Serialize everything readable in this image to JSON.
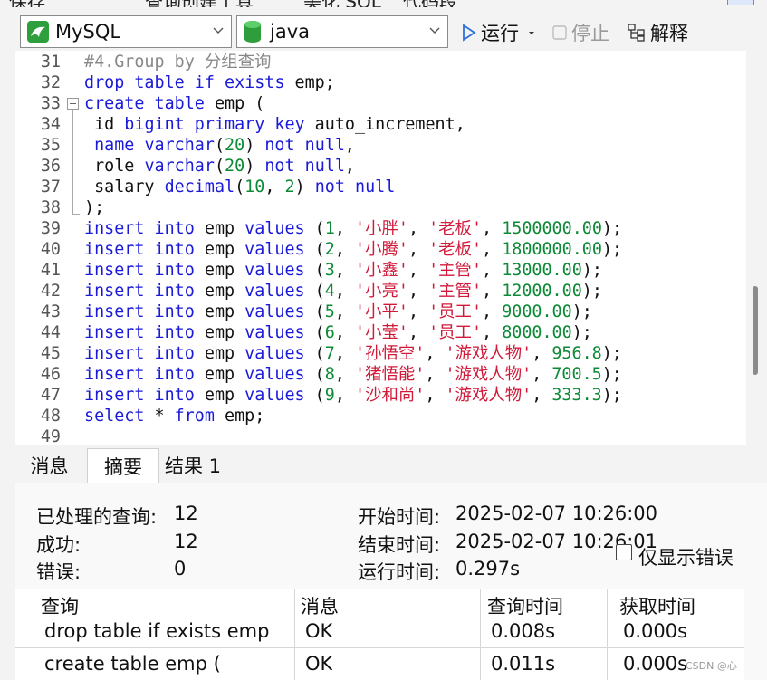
{
  "top_toolbar": {
    "fragments": [
      "保存",
      "查询创建工具",
      "美化 SQL",
      "代码段"
    ]
  },
  "toolbar": {
    "connection_value": "MySQL",
    "database_value": "java",
    "run_label": "运行",
    "stop_label": "停止",
    "explain_label": "解释"
  },
  "editor": {
    "lines": [
      {
        "n": "31",
        "tokens": [
          {
            "t": "#4.Group by 分组查询",
            "c": "cm"
          }
        ]
      },
      {
        "n": "32",
        "tokens": [
          {
            "t": "drop table if exists",
            "c": "kw"
          },
          {
            "t": " emp;",
            "c": "id"
          }
        ]
      },
      {
        "n": "33",
        "tokens": [
          {
            "t": "create table",
            "c": "kw"
          },
          {
            "t": " emp (",
            "c": "id"
          }
        ]
      },
      {
        "n": "34",
        "tokens": [
          {
            "t": " id ",
            "c": "id"
          },
          {
            "t": "bigint primary key",
            "c": "kw"
          },
          {
            "t": " auto_increment,",
            "c": "id"
          }
        ]
      },
      {
        "n": "35",
        "tokens": [
          {
            "t": " ",
            "c": "id"
          },
          {
            "t": "name varchar",
            "c": "kw"
          },
          {
            "t": "(",
            "c": "id"
          },
          {
            "t": "20",
            "c": "num"
          },
          {
            "t": ") ",
            "c": "id"
          },
          {
            "t": "not null",
            "c": "kw"
          },
          {
            "t": ",",
            "c": "id"
          }
        ]
      },
      {
        "n": "36",
        "tokens": [
          {
            "t": " role ",
            "c": "id"
          },
          {
            "t": "varchar",
            "c": "kw"
          },
          {
            "t": "(",
            "c": "id"
          },
          {
            "t": "20",
            "c": "num"
          },
          {
            "t": ") ",
            "c": "id"
          },
          {
            "t": "not null",
            "c": "kw"
          },
          {
            "t": ",",
            "c": "id"
          }
        ]
      },
      {
        "n": "37",
        "tokens": [
          {
            "t": " salary ",
            "c": "id"
          },
          {
            "t": "decimal",
            "c": "kw"
          },
          {
            "t": "(",
            "c": "id"
          },
          {
            "t": "10",
            "c": "num"
          },
          {
            "t": ", ",
            "c": "id"
          },
          {
            "t": "2",
            "c": "num"
          },
          {
            "t": ") ",
            "c": "id"
          },
          {
            "t": "not null",
            "c": "kw"
          }
        ]
      },
      {
        "n": "38",
        "tokens": [
          {
            "t": ");",
            "c": "id"
          }
        ]
      },
      {
        "n": "39",
        "tokens": [
          {
            "t": "insert into",
            "c": "kw"
          },
          {
            "t": " emp ",
            "c": "id"
          },
          {
            "t": "values",
            "c": "kw"
          },
          {
            "t": " (",
            "c": "id"
          },
          {
            "t": "1",
            "c": "num"
          },
          {
            "t": ", ",
            "c": "id"
          },
          {
            "t": "'小胖'",
            "c": "str"
          },
          {
            "t": ", ",
            "c": "id"
          },
          {
            "t": "'老板'",
            "c": "str"
          },
          {
            "t": ", ",
            "c": "id"
          },
          {
            "t": "1500000.00",
            "c": "num"
          },
          {
            "t": ");",
            "c": "id"
          }
        ]
      },
      {
        "n": "40",
        "tokens": [
          {
            "t": "insert into",
            "c": "kw"
          },
          {
            "t": " emp ",
            "c": "id"
          },
          {
            "t": "values",
            "c": "kw"
          },
          {
            "t": " (",
            "c": "id"
          },
          {
            "t": "2",
            "c": "num"
          },
          {
            "t": ", ",
            "c": "id"
          },
          {
            "t": "'小腾'",
            "c": "str"
          },
          {
            "t": ", ",
            "c": "id"
          },
          {
            "t": "'老板'",
            "c": "str"
          },
          {
            "t": ", ",
            "c": "id"
          },
          {
            "t": "1800000.00",
            "c": "num"
          },
          {
            "t": ");",
            "c": "id"
          }
        ]
      },
      {
        "n": "41",
        "tokens": [
          {
            "t": "insert into",
            "c": "kw"
          },
          {
            "t": " emp ",
            "c": "id"
          },
          {
            "t": "values",
            "c": "kw"
          },
          {
            "t": " (",
            "c": "id"
          },
          {
            "t": "3",
            "c": "num"
          },
          {
            "t": ", ",
            "c": "id"
          },
          {
            "t": "'小鑫'",
            "c": "str"
          },
          {
            "t": ", ",
            "c": "id"
          },
          {
            "t": "'主管'",
            "c": "str"
          },
          {
            "t": ", ",
            "c": "id"
          },
          {
            "t": "13000.00",
            "c": "num"
          },
          {
            "t": ");",
            "c": "id"
          }
        ]
      },
      {
        "n": "42",
        "tokens": [
          {
            "t": "insert into",
            "c": "kw"
          },
          {
            "t": " emp ",
            "c": "id"
          },
          {
            "t": "values",
            "c": "kw"
          },
          {
            "t": " (",
            "c": "id"
          },
          {
            "t": "4",
            "c": "num"
          },
          {
            "t": ", ",
            "c": "id"
          },
          {
            "t": "'小亮'",
            "c": "str"
          },
          {
            "t": ", ",
            "c": "id"
          },
          {
            "t": "'主管'",
            "c": "str"
          },
          {
            "t": ", ",
            "c": "id"
          },
          {
            "t": "12000.00",
            "c": "num"
          },
          {
            "t": ");",
            "c": "id"
          }
        ]
      },
      {
        "n": "43",
        "tokens": [
          {
            "t": "insert into",
            "c": "kw"
          },
          {
            "t": " emp ",
            "c": "id"
          },
          {
            "t": "values",
            "c": "kw"
          },
          {
            "t": " (",
            "c": "id"
          },
          {
            "t": "5",
            "c": "num"
          },
          {
            "t": ", ",
            "c": "id"
          },
          {
            "t": "'小平'",
            "c": "str"
          },
          {
            "t": ", ",
            "c": "id"
          },
          {
            "t": "'员工'",
            "c": "str"
          },
          {
            "t": ", ",
            "c": "id"
          },
          {
            "t": "9000.00",
            "c": "num"
          },
          {
            "t": ");",
            "c": "id"
          }
        ]
      },
      {
        "n": "44",
        "tokens": [
          {
            "t": "insert into",
            "c": "kw"
          },
          {
            "t": " emp ",
            "c": "id"
          },
          {
            "t": "values",
            "c": "kw"
          },
          {
            "t": " (",
            "c": "id"
          },
          {
            "t": "6",
            "c": "num"
          },
          {
            "t": ", ",
            "c": "id"
          },
          {
            "t": "'小莹'",
            "c": "str"
          },
          {
            "t": ", ",
            "c": "id"
          },
          {
            "t": "'员工'",
            "c": "str"
          },
          {
            "t": ", ",
            "c": "id"
          },
          {
            "t": "8000.00",
            "c": "num"
          },
          {
            "t": ");",
            "c": "id"
          }
        ]
      },
      {
        "n": "45",
        "tokens": [
          {
            "t": "insert into",
            "c": "kw"
          },
          {
            "t": " emp ",
            "c": "id"
          },
          {
            "t": "values",
            "c": "kw"
          },
          {
            "t": " (",
            "c": "id"
          },
          {
            "t": "7",
            "c": "num"
          },
          {
            "t": ", ",
            "c": "id"
          },
          {
            "t": "'孙悟空'",
            "c": "str"
          },
          {
            "t": ", ",
            "c": "id"
          },
          {
            "t": "'游戏人物'",
            "c": "str"
          },
          {
            "t": ", ",
            "c": "id"
          },
          {
            "t": "956.8",
            "c": "num"
          },
          {
            "t": ");",
            "c": "id"
          }
        ]
      },
      {
        "n": "46",
        "tokens": [
          {
            "t": "insert into",
            "c": "kw"
          },
          {
            "t": " emp ",
            "c": "id"
          },
          {
            "t": "values",
            "c": "kw"
          },
          {
            "t": " (",
            "c": "id"
          },
          {
            "t": "8",
            "c": "num"
          },
          {
            "t": ", ",
            "c": "id"
          },
          {
            "t": "'猪悟能'",
            "c": "str"
          },
          {
            "t": ", ",
            "c": "id"
          },
          {
            "t": "'游戏人物'",
            "c": "str"
          },
          {
            "t": ", ",
            "c": "id"
          },
          {
            "t": "700.5",
            "c": "num"
          },
          {
            "t": ");",
            "c": "id"
          }
        ]
      },
      {
        "n": "47",
        "tokens": [
          {
            "t": "insert into",
            "c": "kw"
          },
          {
            "t": " emp ",
            "c": "id"
          },
          {
            "t": "values",
            "c": "kw"
          },
          {
            "t": " (",
            "c": "id"
          },
          {
            "t": "9",
            "c": "num"
          },
          {
            "t": ", ",
            "c": "id"
          },
          {
            "t": "'沙和尚'",
            "c": "str"
          },
          {
            "t": ", ",
            "c": "id"
          },
          {
            "t": "'游戏人物'",
            "c": "str"
          },
          {
            "t": ", ",
            "c": "id"
          },
          {
            "t": "333.3",
            "c": "num"
          },
          {
            "t": ");",
            "c": "id"
          }
        ]
      },
      {
        "n": "48",
        "tokens": [
          {
            "t": "select",
            "c": "kw"
          },
          {
            "t": " * ",
            "c": "id"
          },
          {
            "t": "from",
            "c": "kw"
          },
          {
            "t": " emp;",
            "c": "id"
          }
        ]
      },
      {
        "n": "49",
        "tokens": []
      }
    ]
  },
  "tabs": [
    {
      "label": "消息",
      "active": false
    },
    {
      "label": "摘要",
      "active": true
    },
    {
      "label": "结果 1",
      "active": false
    }
  ],
  "summary": {
    "processed_label": "已处理的查询:",
    "processed_value": "12",
    "success_label": "成功:",
    "success_value": "12",
    "error_label": "错误:",
    "error_value": "0",
    "start_label": "开始时间:",
    "start_value": "2025-02-07 10:26:00",
    "end_label": "结束时间:",
    "end_value": "2025-02-07 10:26:01",
    "elapsed_label": "运行时间:",
    "elapsed_value": "0.297s",
    "errors_only_label": "仅显示错误",
    "errors_only_checked": false
  },
  "result_table": {
    "columns": [
      "查询",
      "消息",
      "查询时间",
      "获取时间"
    ],
    "rows": [
      [
        "drop table if exists emp",
        "OK",
        "0.008s",
        "0.000s"
      ],
      [
        "create table emp (",
        "OK",
        "0.011s",
        "0.000s"
      ]
    ]
  },
  "watermark": "CSDN @心",
  "colors": {
    "keyword": "#1a1ad8",
    "number": "#0d8a36",
    "string": "#d11a3a",
    "comment": "#888888",
    "run_icon": "#2f6fd6"
  }
}
